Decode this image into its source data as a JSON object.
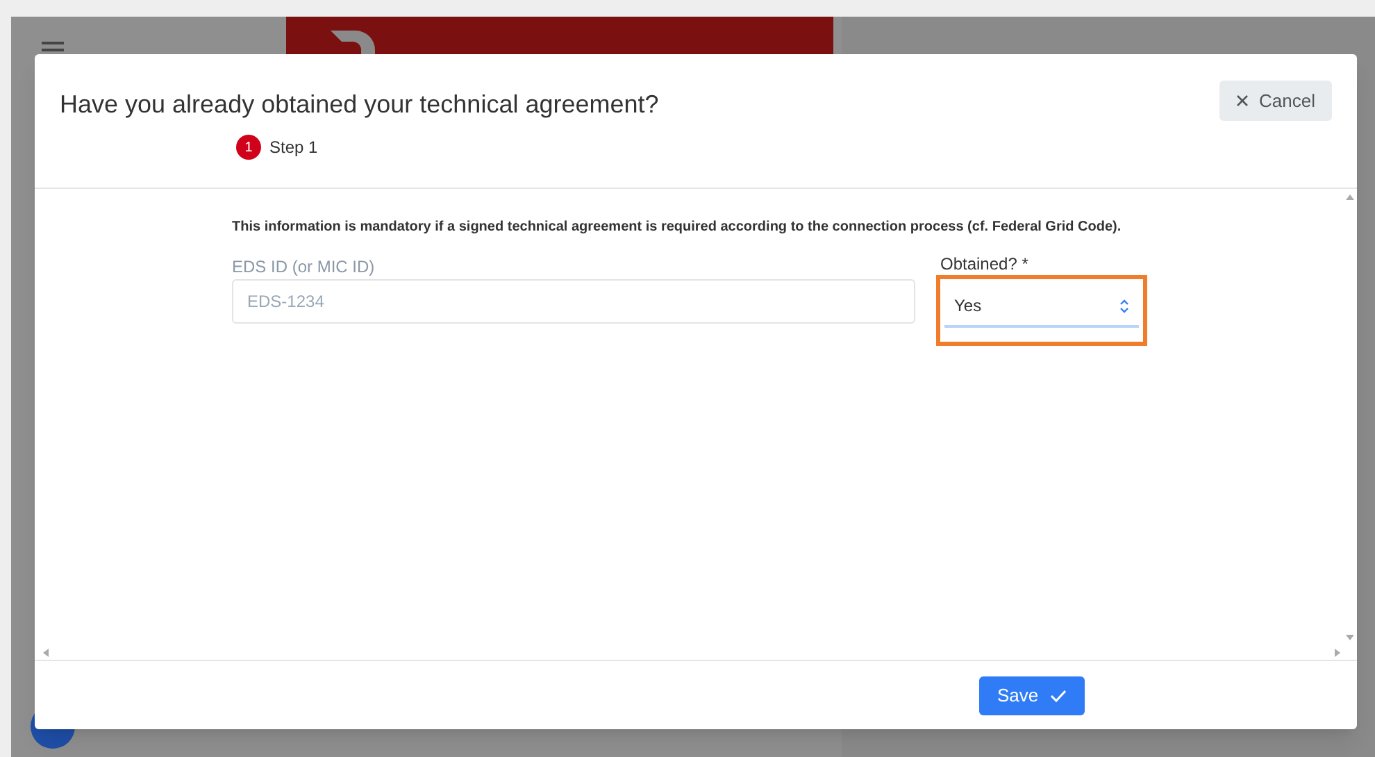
{
  "dialog": {
    "title": "Have you already obtained your technical agreement?",
    "cancel_label": "Cancel",
    "steps": [
      {
        "number": "1",
        "label": "Step 1",
        "selected": true
      }
    ],
    "notice": "This information is mandatory if a signed technical agreement is required according to the connection process (cf. Federal Grid Code).",
    "fields": [
      {
        "kind": "text",
        "label": "EDS ID (or MIC ID)",
        "placeholder": "EDS-1234"
      },
      {
        "kind": "select",
        "label": "Obtained? *",
        "value": "Yes",
        "highlighted": true
      }
    ],
    "save_label": "Save"
  }
}
